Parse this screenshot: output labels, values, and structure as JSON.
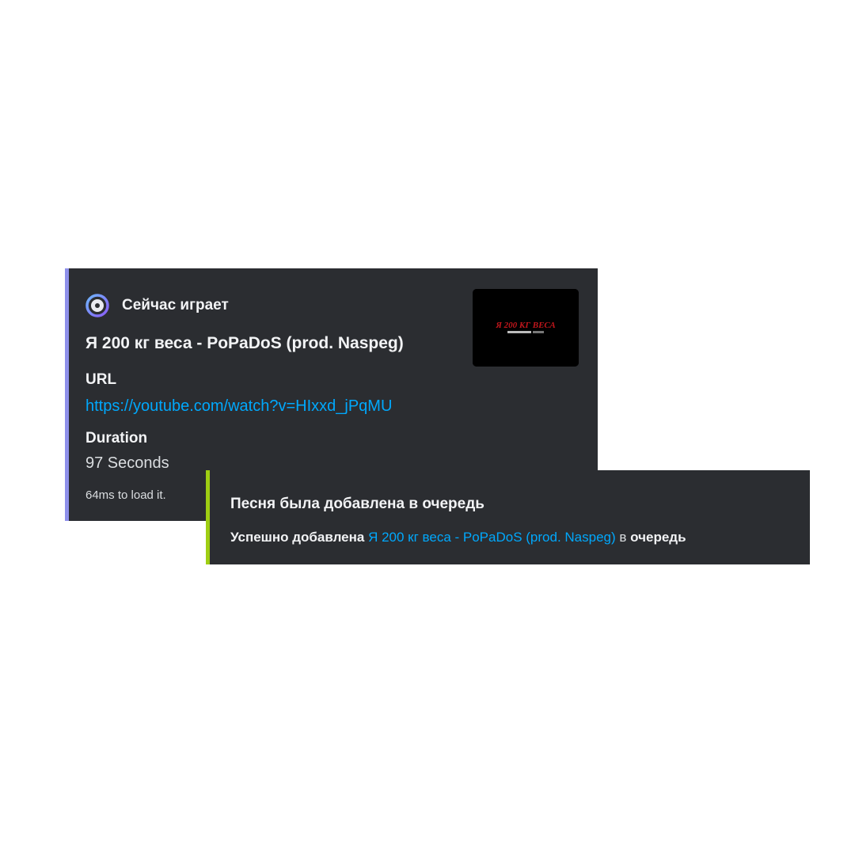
{
  "now_playing": {
    "author": "Сейчас играет",
    "title": "Я 200 кг веса - PoPaDoS (prod. Naspeg)",
    "fields": [
      {
        "name": "URL",
        "value": "https://youtube.com/watch?v=HIxxd_jPqMU"
      },
      {
        "name": "Duration",
        "value": "97 Seconds"
      }
    ],
    "footer": "64ms to load it.",
    "thumbnail_text": "Я 200 КГ ВЕСА",
    "accent_color": "#8e90ea",
    "icon": "disc-icon"
  },
  "queue": {
    "title": "Песня была добавлена в очередь",
    "prefix": "Успешно добавлена",
    "song_link": "Я 200 кг веса - PoPaDoS (prod. Naspeg)",
    "middle": "в",
    "suffix": "очередь",
    "accent_color": "#9fce13"
  }
}
